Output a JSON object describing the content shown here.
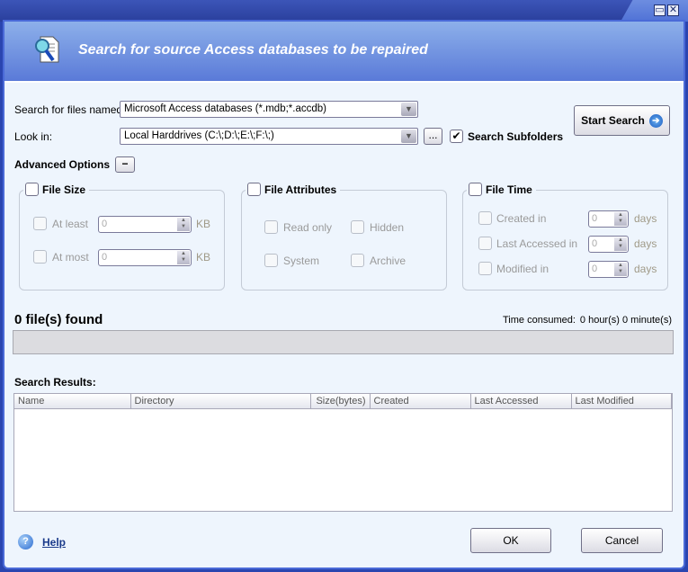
{
  "window": {
    "restore_icon": "restore-icon",
    "close_icon": "close-icon"
  },
  "header": {
    "title": "Search for source Access databases to be repaired",
    "icon": "search-document-icon"
  },
  "search": {
    "files_named_label": "Search for files named:",
    "files_named_value": "Microsoft Access databases (*.mdb;*.accdb)",
    "look_in_label": "Look in:",
    "look_in_value": "Local Harddrives (C:\\;D:\\;E:\\;F:\\;)",
    "browse_label": "...",
    "subfolders_label": "Search Subfolders",
    "subfolders_checked": true,
    "start_label": "Start Search"
  },
  "advanced": {
    "label": "Advanced Options",
    "toggle": "−",
    "file_size": {
      "title": "File Size",
      "at_least": "At least",
      "at_most": "At most",
      "at_least_value": "0",
      "at_most_value": "0",
      "unit": "KB"
    },
    "file_attributes": {
      "title": "File Attributes",
      "read_only": "Read only",
      "hidden": "Hidden",
      "system": "System",
      "archive": "Archive"
    },
    "file_time": {
      "title": "File Time",
      "created": "Created in",
      "accessed": "Last Accessed in",
      "modified": "Modified in",
      "created_value": "0",
      "accessed_value": "0",
      "modified_value": "0",
      "unit": "days"
    }
  },
  "status": {
    "found": "0 file(s) found",
    "time_label": "Time consumed:",
    "time_value": "0 hour(s) 0 minute(s)",
    "progress": 0
  },
  "results": {
    "label": "Search Results:",
    "columns": [
      "Name",
      "Directory",
      "Size(bytes)",
      "Created",
      "Last Accessed",
      "Last Modified"
    ],
    "rows": []
  },
  "footer": {
    "help": "Help",
    "ok": "OK",
    "cancel": "Cancel"
  }
}
